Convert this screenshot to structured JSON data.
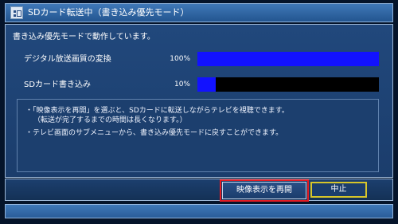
{
  "window": {
    "title": "SDカード転送中（書き込み優先モード）",
    "icon": "sd-card-icon",
    "colors": {
      "title_bar": "#2f64a6",
      "panel": "#1b3d6c",
      "background": "#05142a"
    }
  },
  "status": "書き込み優先モードで動作しています。",
  "progress_rows": [
    {
      "label": "デジタル放送画質の変換",
      "percent_text": "100%",
      "value": 1.0
    },
    {
      "label": "SDカード書き込み",
      "percent_text": "10%",
      "value": 0.1
    }
  ],
  "progress_color": "#1212ff",
  "notes": [
    "・「映像表示を再開」を選ぶと、SDカードに転送しながらテレビを視聴できます。",
    "（転送が完了するまでの時間は長くなります。）",
    "・テレビ画面のサブメニューから、書き込み優先モードに戻すことができます。"
  ],
  "buttons": {
    "resume_label": "映像表示を再開",
    "stop_label": "中止",
    "highlight_color": "#e31b23",
    "focus_color": "#d7c52a"
  }
}
